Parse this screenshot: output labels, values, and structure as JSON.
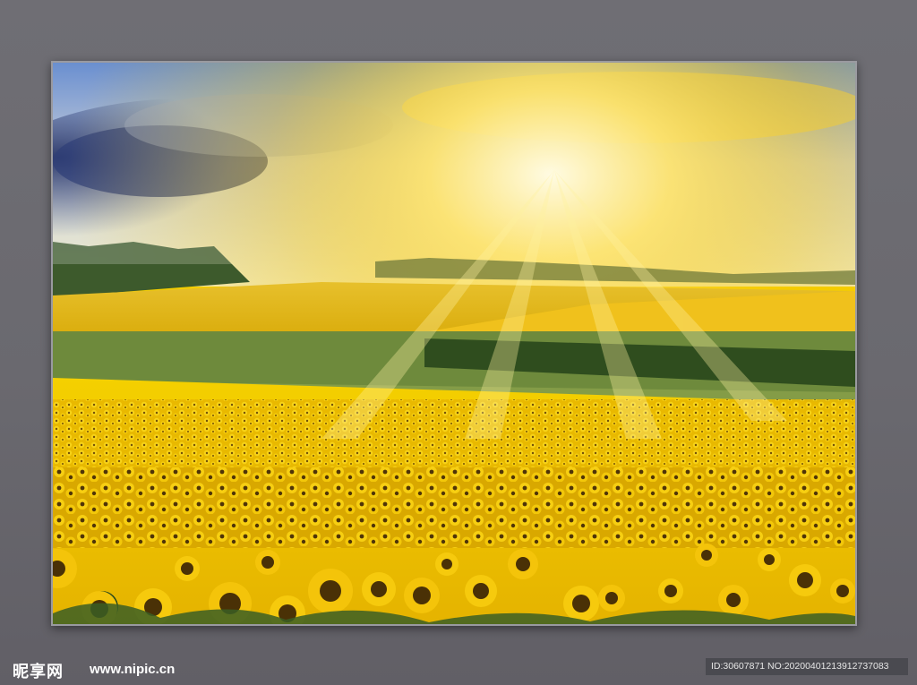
{
  "image": {
    "subject": "sunflower-field-with-sun-rays",
    "colors": {
      "sky_dark": "#3c4d8a",
      "sun": "#fff6c0",
      "field": "#e0b400",
      "sunflower_petal": "#f3c300",
      "sunflower_center": "#4a3208",
      "foliage": "#3f6a2a"
    }
  },
  "watermark": {
    "logo_text": "昵享网",
    "url_text": "www.nipic.cn",
    "id_text": "ID:30607871 NO:20200401213912737083"
  }
}
